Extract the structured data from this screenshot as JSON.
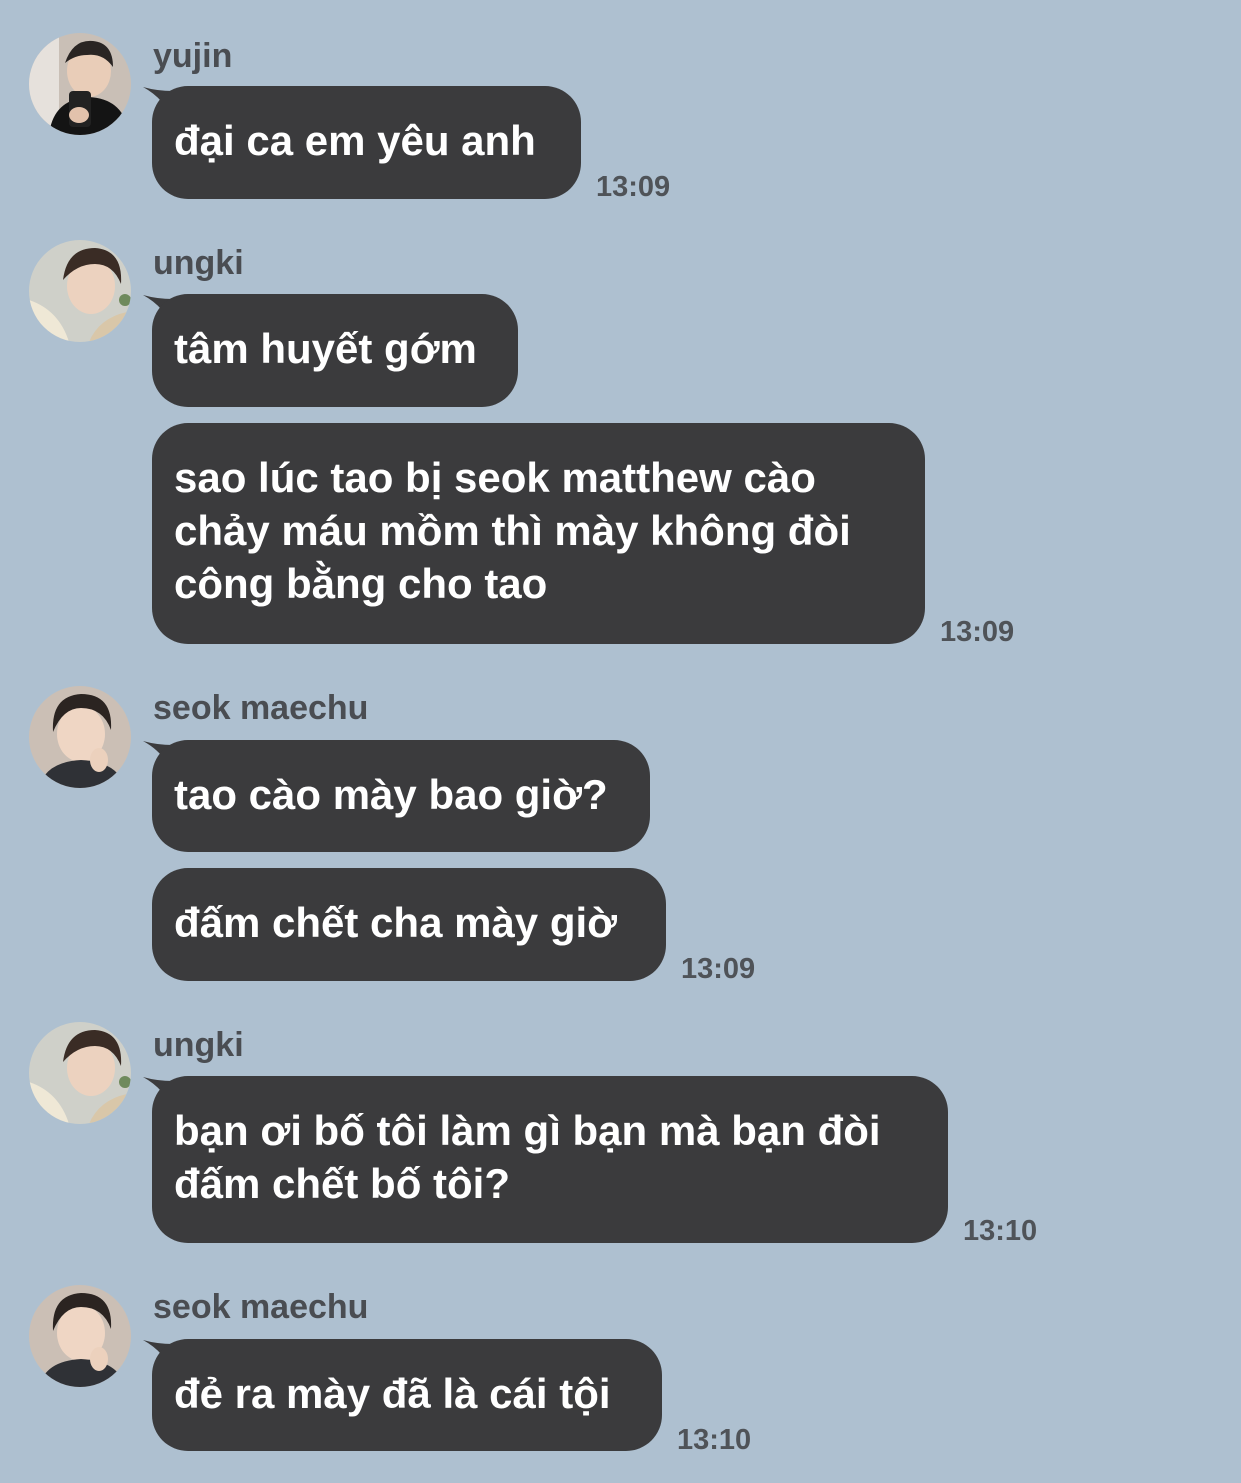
{
  "chat": {
    "messages": [
      {
        "sender": "yujin",
        "lines": [
          "đại ca em yêu anh"
        ],
        "time": "13:09"
      },
      {
        "sender": "ungki",
        "lines": [
          "tâm huyết gớm"
        ]
      },
      {
        "lines": [
          "sao lúc tao bị seok matthew cào",
          "chảy máu mồm thì mày không đòi",
          "công bằng cho tao"
        ],
        "time": "13:09"
      },
      {
        "sender": "seok maechu",
        "lines": [
          "tao cào mày bao giờ?"
        ]
      },
      {
        "lines": [
          "đấm chết cha mày giờ"
        ],
        "time": "13:09"
      },
      {
        "sender": "ungki",
        "lines": [
          "bạn ơi bố tôi làm gì bạn mà bạn đòi",
          "đấm chết bố tôi?"
        ],
        "time": "13:10"
      },
      {
        "sender": "seok maechu",
        "lines": [
          "đẻ ra mày đã là cái tội"
        ],
        "time": "13:10"
      }
    ]
  },
  "colors": {
    "background": "#aec0d0",
    "bubble": "#3b3b3d",
    "bubble_text": "#ffffff",
    "meta_text": "#4f5358"
  }
}
